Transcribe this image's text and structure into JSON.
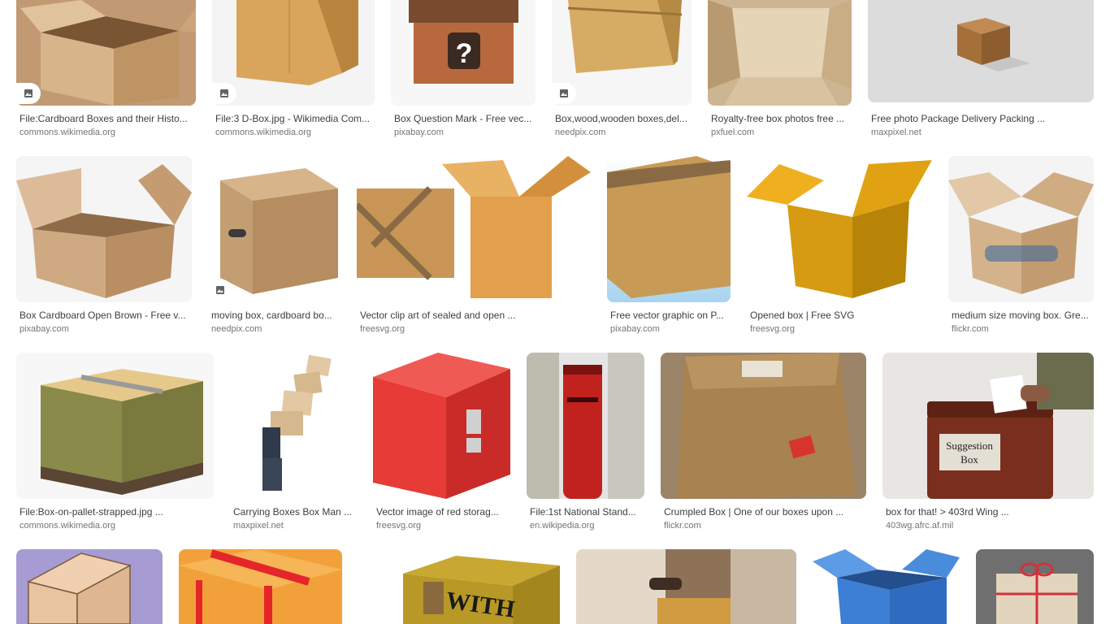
{
  "results": [
    {
      "title": "File:Cardboard Boxes and their Histo...",
      "source": "commons.wikimedia.org",
      "icon": "image-icon"
    },
    {
      "title": "File:3 D-Box.jpg - Wikimedia Com...",
      "source": "commons.wikimedia.org",
      "icon": "image-icon"
    },
    {
      "title": "Box Question Mark - Free vec...",
      "source": "pixabay.com",
      "icon": ""
    },
    {
      "title": "Box,wood,wooden boxes,del...",
      "source": "needpix.com",
      "icon": "image-icon"
    },
    {
      "title": "Royalty-free box photos free ...",
      "source": "pxfuel.com",
      "icon": ""
    },
    {
      "title": "Free photo Package Delivery Packing ...",
      "source": "maxpixel.net",
      "icon": ""
    },
    {
      "title": "Box Cardboard Open Brown - Free v...",
      "source": "pixabay.com",
      "icon": ""
    },
    {
      "title": "moving box, cardboard bo...",
      "source": "needpix.com",
      "icon": "image-icon"
    },
    {
      "title": "Vector clip art of sealed and open ...",
      "source": "freesvg.org",
      "icon": ""
    },
    {
      "title": "Free vector graphic on P...",
      "source": "pixabay.com",
      "icon": ""
    },
    {
      "title": "Opened box | Free SVG",
      "source": "freesvg.org",
      "icon": ""
    },
    {
      "title": "medium size moving box. Gre...",
      "source": "flickr.com",
      "icon": ""
    },
    {
      "title": "File:Box-on-pallet-strapped.jpg ...",
      "source": "commons.wikimedia.org",
      "icon": ""
    },
    {
      "title": "Carrying Boxes Box Man ...",
      "source": "maxpixel.net",
      "icon": ""
    },
    {
      "title": "Vector image of red storag...",
      "source": "freesvg.org",
      "icon": ""
    },
    {
      "title": "File:1st National Stand...",
      "source": "en.wikipedia.org",
      "icon": ""
    },
    {
      "title": "Crumpled Box | One of our boxes upon ...",
      "source": "flickr.com",
      "icon": ""
    },
    {
      "title": "box for that! > 403rd Wing ...",
      "source": "403wg.afrc.af.mil",
      "icon": ""
    },
    {
      "title": "",
      "source": "",
      "icon": ""
    },
    {
      "title": "",
      "source": "",
      "icon": ""
    },
    {
      "title": "",
      "source": "",
      "icon": ""
    },
    {
      "title": "",
      "source": "",
      "icon": ""
    },
    {
      "title": "",
      "source": "",
      "icon": ""
    },
    {
      "title": "",
      "source": "",
      "icon": ""
    }
  ],
  "suggestion_box_label": [
    "Suggestion",
    "Box"
  ],
  "with_text": "WITH",
  "colors": {
    "title": "#3c4043",
    "source": "#70757a",
    "cardboard": "#c9a06a"
  }
}
